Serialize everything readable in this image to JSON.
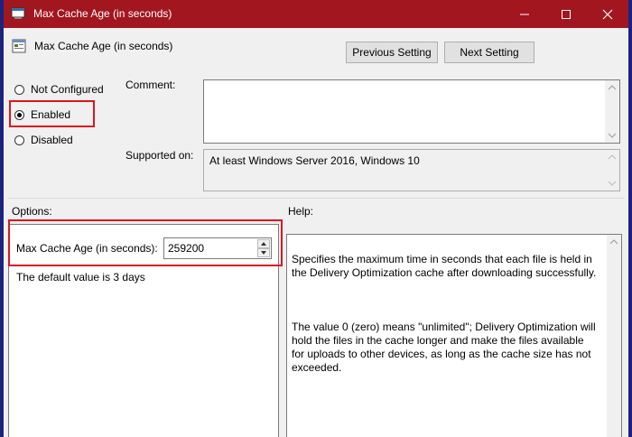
{
  "window": {
    "title": "Max Cache Age (in seconds)"
  },
  "header": {
    "policy_name": "Max Cache Age (in seconds)",
    "prev_label": "Previous Setting",
    "next_label": "Next Setting"
  },
  "state": {
    "not_configured_label": "Not Configured",
    "enabled_label": "Enabled",
    "disabled_label": "Disabled",
    "selected": "Enabled"
  },
  "comment": {
    "label": "Comment:",
    "value": ""
  },
  "supported": {
    "label": "Supported on:",
    "value": "At least Windows Server 2016, Windows 10"
  },
  "options": {
    "label": "Options:",
    "field_label": "Max Cache Age (in seconds):",
    "field_value": "259200",
    "default_note": "The default value is 3 days"
  },
  "help": {
    "label": "Help:",
    "paragraph1": "Specifies the maximum time in seconds that each file is held in the Delivery Optimization cache after downloading successfully.",
    "paragraph2": "The value 0 (zero) means \"unlimited\"; Delivery Optimization will hold the files in the cache longer and make the files available for uploads to other devices, as long as the cache size has not exceeded."
  },
  "colors": {
    "titlebar": "#a2161f",
    "highlight": "#e0141e",
    "background": "#f0f0f0"
  }
}
